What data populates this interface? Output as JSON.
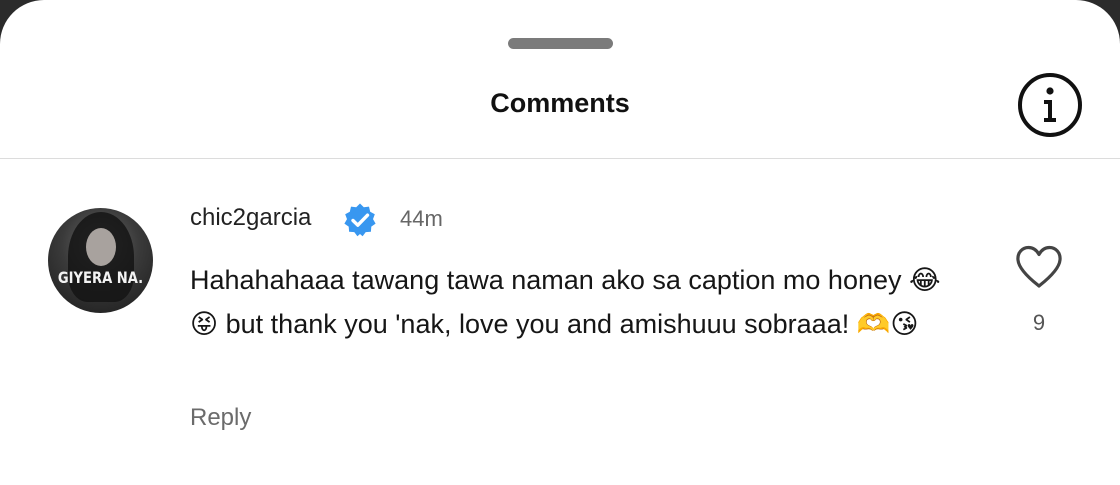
{
  "header": {
    "title": "Comments",
    "info_icon": "info-circle-icon"
  },
  "comment": {
    "avatar_text": "GIYERA NA.",
    "username": "chic2garcia",
    "verified": true,
    "time": "44m",
    "text": "Hahahahaaa tawang tawa naman ako sa caption mo honey 😂😝 but thank you 'nak, love you and amishuuu sobraaa! 🫶😘",
    "reply_label": "Reply",
    "like_count": "9",
    "like_icon": "heart-outline-icon"
  },
  "colors": {
    "verified_blue": "#3897f0",
    "text_primary": "#161616",
    "text_secondary": "#6b6b6b"
  }
}
